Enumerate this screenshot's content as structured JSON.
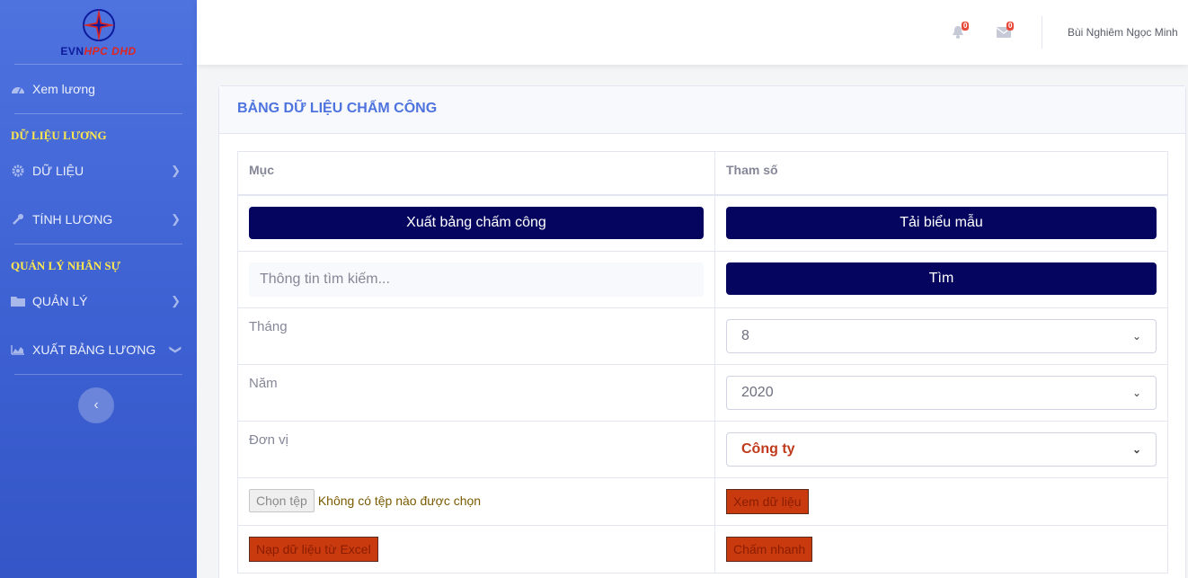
{
  "brand": {
    "evn": "EVN",
    "rest": "HPC DHD"
  },
  "sidebar": {
    "top_item": "Xem lương",
    "heading1": "DỮ LIỆU LƯƠNG",
    "item_data": "DỮ LIỆU",
    "item_calc": "TÍNH LƯƠNG",
    "heading2": "QUẢN LÝ NHÂN SỰ",
    "item_manage": "QUẢN LÝ",
    "item_export": "XUẤT BẢNG LƯƠNG"
  },
  "topbar": {
    "alerts_count": "0",
    "messages_count": "0",
    "user_name": "Bùi Nghiêm Ngọc Minh"
  },
  "card": {
    "title": "BẢNG DỮ LIỆU CHẤM CÔNG",
    "col_item": "Mục",
    "col_param": "Tham số",
    "export_button": "Xuất bảng chấm công",
    "download_template_button": "Tải biểu mẫu",
    "search_placeholder": "Thông tin tìm kiếm...",
    "search_button": "Tìm",
    "month_label": "Tháng",
    "month_value": "8",
    "year_label": "Năm",
    "year_value": "2020",
    "unit_label": "Đơn vị",
    "unit_value": "Công ty",
    "choose_file_button": "Chọn tệp",
    "no_file_text": "Không có tệp nào được chọn",
    "view_data_button": "Xem dữ liệu",
    "import_excel_button": "Nạp dữ liệu từ Excel",
    "quick_timekeeping_button": "Chấm nhanh"
  },
  "colors": {
    "sidebar": "#4e73df",
    "navy_button": "#05055f",
    "orange_button": "#c93b0f",
    "heading_yellow": "#ffe84d"
  }
}
